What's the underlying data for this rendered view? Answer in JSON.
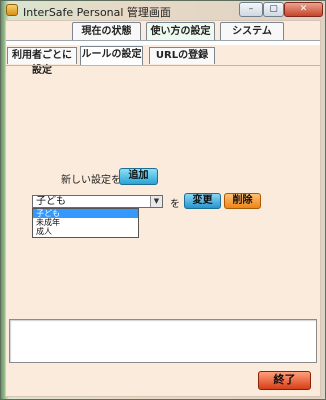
{
  "window": {
    "title": "InterSafe Personal 管理画面",
    "controls": {
      "minimize": "–",
      "maximize": "▢",
      "close": "✕"
    }
  },
  "tabs": {
    "top": [
      {
        "label": "現在の状態"
      },
      {
        "label": "使い方の設定",
        "active": true
      },
      {
        "label": "システム"
      }
    ],
    "sub": [
      {
        "label": "利用者ごとに設定"
      },
      {
        "label": "ルールの設定",
        "active": true
      },
      {
        "label": "URLの登録"
      }
    ]
  },
  "rule_panel": {
    "new_setting_label": "新しい設定を",
    "add_button": "追加",
    "select_value": "子ども",
    "dropdown_options": [
      {
        "label": "子ども",
        "selected": true
      },
      {
        "label": "未成年"
      },
      {
        "label": "成人"
      }
    ],
    "wo_label": "を",
    "change_button": "変更",
    "delete_button": "削除"
  },
  "footer": {
    "message": "",
    "exit_button": "終了"
  },
  "colors": {
    "window_bg": "#fbebdd",
    "add_button": "#2ba3d6",
    "change_button": "#2894cf",
    "delete_button": "#ee8417",
    "exit_button": "#d63f18",
    "selection": "#3399ff"
  }
}
